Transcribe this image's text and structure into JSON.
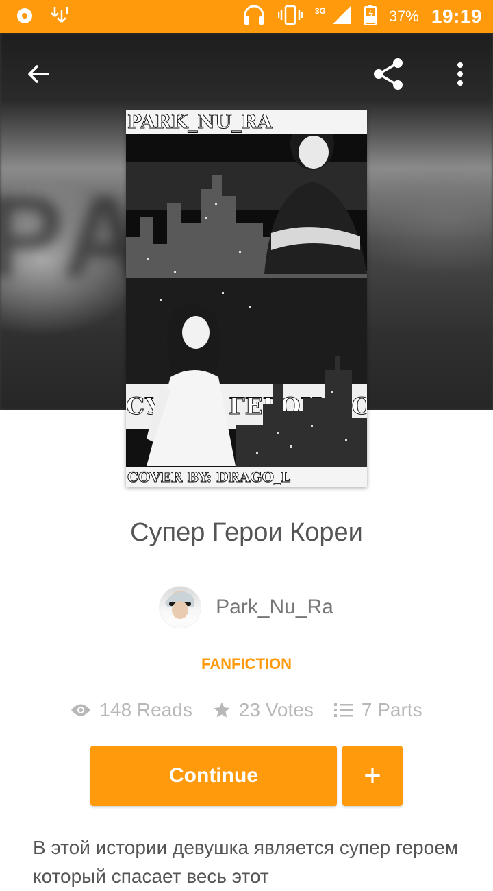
{
  "status_bar": {
    "time": "19:19",
    "battery": "37%",
    "network": "3G",
    "icons": [
      "app-icon",
      "download-icon",
      "headphones-icon",
      "vibrate-icon",
      "signal-icon",
      "battery-icon"
    ]
  },
  "header": {
    "back_icon": "arrow-back-icon",
    "share_icon": "share-icon",
    "menu_icon": "more-vert-icon"
  },
  "cover": {
    "top_text": "PARK_NU_RA",
    "middle_text": "СУПЕР ГЕРОИ КОРЕИ",
    "bottom_text": "COVER BY: DRAGO_L"
  },
  "story": {
    "title": "Супер Герои Кореи",
    "author": "Park_Nu_Ra",
    "category": "FANFICTION",
    "stats": {
      "reads": "148 Reads",
      "votes": "23 Votes",
      "parts": "7 Parts"
    },
    "continue_label": "Continue",
    "add_label": "+",
    "description": "В этой истории девушка является супер героем который спасает весь этот"
  },
  "colors": {
    "accent": "#ff9a0d",
    "text_dark": "#555555",
    "text_muted": "#b8b8b8"
  }
}
